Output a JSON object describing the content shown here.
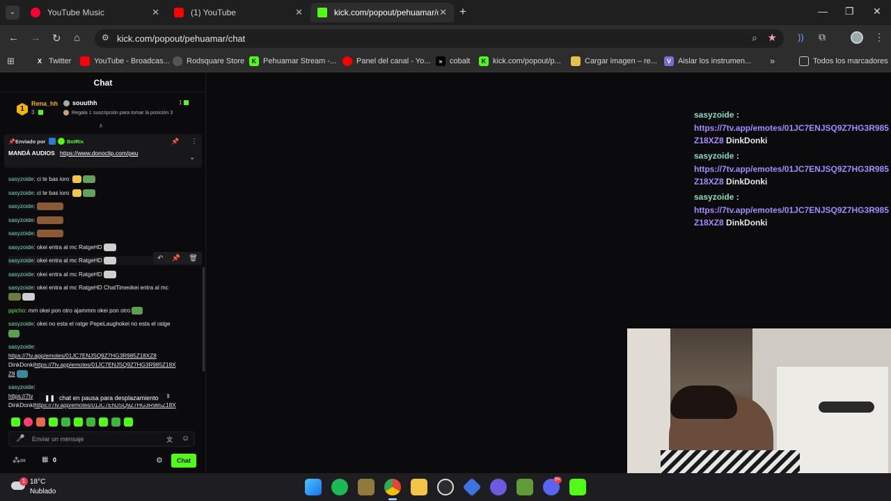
{
  "browser": {
    "tabs": [
      {
        "title": "YouTube Music",
        "close": "✕"
      },
      {
        "title": "(1) YouTube",
        "close": "✕"
      },
      {
        "title": "kick.com/popout/pehuamar/ch",
        "close": "✕"
      }
    ],
    "new_tab": "+",
    "url": "kick.com/popout/pehuamar/chat",
    "bookmarks": [
      "Twitter",
      "YouTube - Broadcas...",
      "Rodsquare Store",
      "Pehuamar Stream -...",
      "Panel del canal - Yo...",
      "cobalt",
      "kick.com/popout/p...",
      "Cargar imagen – re...",
      "Aislar los instrumen..."
    ],
    "all_bookmarks": "Todos los marcadores"
  },
  "chat": {
    "title": "Chat",
    "leaderboard": {
      "rank": "1",
      "first_user": "Rena_hh",
      "first_count": "3",
      "second_user": "souuthh",
      "second_count": "1",
      "hint": "Regala 1 suscripción para tomar la posición 3"
    },
    "pinned": {
      "sent_by": "Enviado por",
      "bot": "BotRix",
      "text": "MANDÁ AUDIOS",
      "link": "https://www.donoclip.com/peu"
    },
    "messages": [
      {
        "user": "sasyzoide",
        "text": ": ci te bas ioro "
      },
      {
        "user": "sasyzoide",
        "text": ": ci te bas ioro "
      },
      {
        "user": "sasyzoide",
        "text": ":"
      },
      {
        "user": "sasyzoide",
        "text": ":"
      },
      {
        "user": "sasyzoide",
        "text": ":"
      },
      {
        "user": "sasyzoide",
        "text": ": okei entra al mc RatgeHD"
      },
      {
        "user": "sasyzoide",
        "text": ": okei entra al mc RatgeHD"
      },
      {
        "user": "sasyzoide",
        "text": ": okei entra al mc RatgeHD"
      },
      {
        "user": "sasyzoide",
        "text": ": okei entra al mc RatgeHD ChatTimeokei entra al mc"
      },
      {
        "user": "ppicho",
        "text": ": mm okei pon otro ajammm okei pon otro"
      },
      {
        "user": "sasyzoide",
        "text": ": okei no esta el ratge PepeLaughokei no esta el ratge"
      },
      {
        "user": "sasyzoide",
        "text": ":"
      },
      {
        "user": "sasyzoide",
        "text": ":"
      }
    ],
    "link_msg": {
      "line1": "https://7tv.app/emotes/01JC7ENJSQ9Z7HG3R985Z18XZ8",
      "line2_prefix": "DinkDonki",
      "line2_link": "https://7tv.app/emotes/01JC7ENJSQ9Z7HG3R985Z18X",
      "line3": "Z8"
    },
    "link_msg_partial": {
      "line1": "https://7tv",
      "line1_end": "8",
      "line2": "DinkDonki",
      "line2_link": "https://7tv.app/emotes/01JC7ENJSQ9Z7HG3R985Z18X"
    },
    "paused": "chat en pausa para desplazamiento",
    "input_placeholder": "Enviar un mensaje",
    "footer_count": "0",
    "send_label": "Chat"
  },
  "overlay": {
    "entries": [
      {
        "user": "sasyzoide",
        "sep": ":",
        "url1": "https://7tv.app/emotes/01JC7ENJSQ9Z7HG3R985",
        "url2": "Z18XZ8",
        "emote": "DinkDonki"
      },
      {
        "user": "sasyzoide",
        "sep": ":",
        "url1": "https://7tv.app/emotes/01JC7ENJSQ9Z7HG3R985",
        "url2": "Z18XZ8",
        "emote": "DinkDonki"
      },
      {
        "user": "sasyzoide",
        "sep": ":",
        "url1": "https://7tv.app/emotes/01JC7ENJSQ9Z7HG3R985",
        "url2": "Z18XZ8",
        "emote": "DinkDonki"
      }
    ]
  },
  "taskbar": {
    "weather_temp": "18°C",
    "weather_desc": "Nublado",
    "weather_badge": "1",
    "discord_badge": "9+"
  },
  "colors": {
    "kick_green": "#53fc18",
    "username_teal": "#7fe0c0",
    "link_purple": "#a58bff"
  }
}
